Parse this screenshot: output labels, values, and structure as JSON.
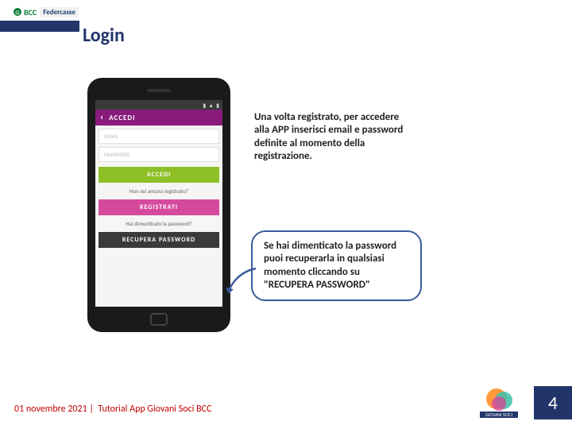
{
  "brand": {
    "bcc": "BCC",
    "federcasse": "Federcasse"
  },
  "page_title": "Login",
  "phone": {
    "titlebar": "ACCEDI",
    "email_placeholder": "EMAIL",
    "password_placeholder": "PASSWORD",
    "btn_accedi": "ACCEDI",
    "helper_register": "Non sei ancora registrato?",
    "btn_registrati": "REGISTRATI",
    "helper_forgot": "Hai dimenticato la password?",
    "btn_recupera": "RECUPERA PASSWORD"
  },
  "desc1": "Una volta registrato, per accedere alla APP inserisci email e password definite al momento della registrazione.",
  "desc2": "Se hai dimenticato la password puoi recuperarla in qualsiasi momento cliccando su \"RECUPERA PASSWORD\"",
  "footer": {
    "date": "01 novembre 2021",
    "title": "Tutorial App Giovani Soci BCC",
    "page": "4",
    "logo_text": "GIOVANI SOCI"
  }
}
